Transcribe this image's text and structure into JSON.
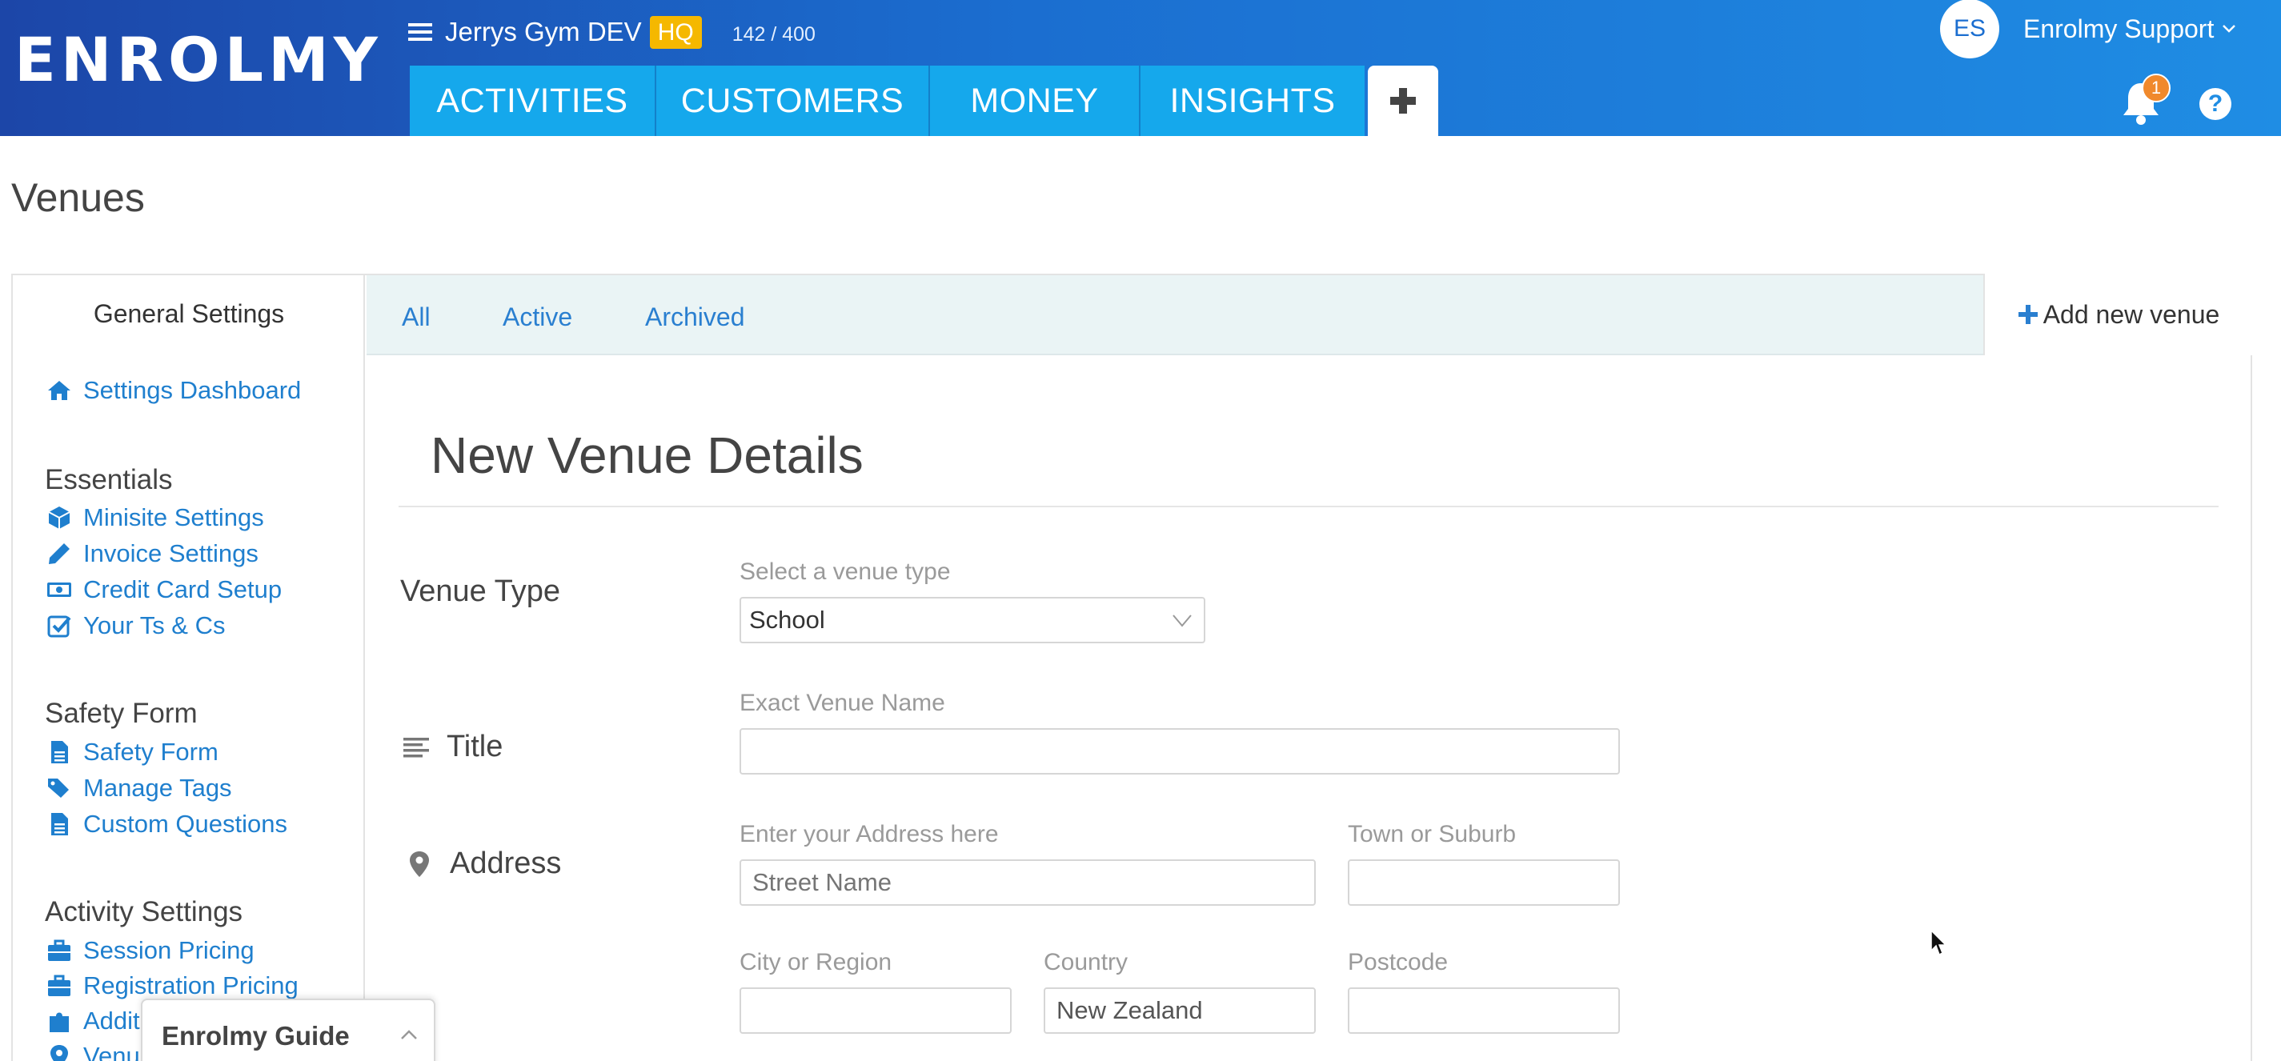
{
  "header": {
    "logo_text": "ENROLMY",
    "org_name": "Jerrys Gym DEV",
    "org_badge": "HQ",
    "usage": "142 / 400",
    "nav_tabs": [
      {
        "label": "ACTIVITIES"
      },
      {
        "label": "CUSTOMERS"
      },
      {
        "label": "MONEY"
      },
      {
        "label": "INSIGHTS"
      }
    ],
    "user_initials": "ES",
    "user_name": "Enrolmy Support",
    "notification_count": "1",
    "help_glyph": "?"
  },
  "page": {
    "title": "Venues"
  },
  "sidebar": {
    "title": "General Settings",
    "top_link": {
      "label": "Settings Dashboard",
      "icon": "home-icon"
    },
    "sections": [
      {
        "title": "Essentials",
        "links": [
          {
            "label": "Minisite Settings",
            "icon": "cube-icon"
          },
          {
            "label": "Invoice Settings",
            "icon": "pencil-icon"
          },
          {
            "label": "Credit Card Setup",
            "icon": "money-icon"
          },
          {
            "label": "Your Ts & Cs",
            "icon": "check-square-icon"
          }
        ]
      },
      {
        "title": "Safety Form",
        "links": [
          {
            "label": "Safety Form",
            "icon": "file-icon"
          },
          {
            "label": "Manage Tags",
            "icon": "tags-icon"
          },
          {
            "label": "Custom Questions",
            "icon": "file-icon"
          }
        ]
      },
      {
        "title": "Activity Settings",
        "links": [
          {
            "label": "Session Pricing",
            "icon": "briefcase-icon"
          },
          {
            "label": "Registration Pricing",
            "icon": "briefcase-icon"
          },
          {
            "label": "Additi",
            "icon": "puzzle-icon"
          },
          {
            "label": "Venu",
            "icon": "map-marker-icon"
          }
        ]
      }
    ]
  },
  "tabs": {
    "all": "All",
    "active": "Active",
    "archived": "Archived",
    "add_new": "Add new venue"
  },
  "form": {
    "title": "New Venue Details",
    "venue_type": {
      "label": "Venue Type",
      "hint": "Select a venue type",
      "value": "School"
    },
    "title_row": {
      "label": "Title",
      "hint": "Exact Venue Name",
      "value": ""
    },
    "address": {
      "label": "Address",
      "street_hint": "Enter your Address here",
      "street_placeholder": "Street Name",
      "town_hint": "Town or Suburb",
      "town_value": "",
      "city_hint": "City or Region",
      "city_value": "",
      "country_hint": "Country",
      "country_value": "New Zealand",
      "postcode_hint": "Postcode",
      "postcode_value": ""
    }
  },
  "guide": {
    "title": "Enrolmy Guide"
  },
  "colors": {
    "header_start": "#1c46a8",
    "header_end": "#1f8de4",
    "nav_tab": "#15a8ec",
    "link": "#1f7fce",
    "badge": "#f5b800",
    "notification": "#f0892c"
  }
}
